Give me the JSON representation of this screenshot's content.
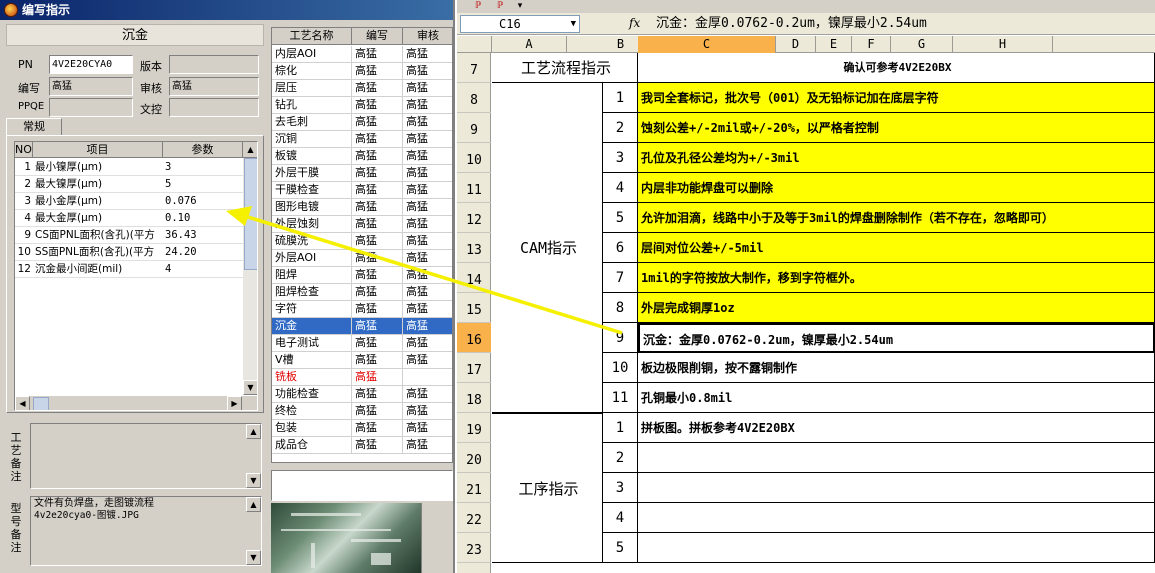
{
  "window": {
    "title": "编写指示"
  },
  "left": {
    "section_button": "沉金",
    "fields": {
      "pn_label": "PN",
      "pn_value": "4V2E20CYA0",
      "version_label": "版本",
      "version_value": "",
      "writer_label": "编写",
      "writer_value": "高猛",
      "reviewer_label": "审核",
      "reviewer_value": "高猛",
      "ppqe_label": "PPQE",
      "ppqe_value": "",
      "control_label": "文控",
      "control_value": ""
    },
    "tab_label": "常规",
    "param_headers": {
      "no": "NO",
      "item": "项目",
      "param": "参数"
    },
    "params": [
      {
        "no": "1",
        "item": "最小镍厚(μm)",
        "value": "3"
      },
      {
        "no": "2",
        "item": "最大镍厚(μm)",
        "value": "5"
      },
      {
        "no": "3",
        "item": "最小金厚(μm)",
        "value": "0.076"
      },
      {
        "no": "4",
        "item": "最大金厚(μm)",
        "value": "0.10"
      },
      {
        "no": "9",
        "item": "CS面PNL面积(含孔)(平方",
        "value": "36.43"
      },
      {
        "no": "10",
        "item": "SS面PNL面积(含孔)(平方",
        "value": "24.20"
      },
      {
        "no": "12",
        "item": "沉金最小间距(mil)",
        "value": "4"
      }
    ],
    "memo1_label": "工艺备注",
    "memo1_text": "",
    "memo2_label": "型号备注",
    "memo2_text_line1": "文件有负焊盘，走图镀流程",
    "memo2_text_line2": "4v2e20cya0-图镀.JPG"
  },
  "process": {
    "headers": {
      "name": "工艺名称",
      "writer": "编写",
      "reviewer": "审核"
    },
    "rows": [
      {
        "name": "内层AOI",
        "writer": "高猛",
        "reviewer": "高猛"
      },
      {
        "name": "棕化",
        "writer": "高猛",
        "reviewer": "高猛"
      },
      {
        "name": "层压",
        "writer": "高猛",
        "reviewer": "高猛"
      },
      {
        "name": "钻孔",
        "writer": "高猛",
        "reviewer": "高猛"
      },
      {
        "name": "去毛刺",
        "writer": "高猛",
        "reviewer": "高猛"
      },
      {
        "name": "沉铜",
        "writer": "高猛",
        "reviewer": "高猛"
      },
      {
        "name": "板镀",
        "writer": "高猛",
        "reviewer": "高猛"
      },
      {
        "name": "外层干膜",
        "writer": "高猛",
        "reviewer": "高猛"
      },
      {
        "name": "干膜检查",
        "writer": "高猛",
        "reviewer": "高猛"
      },
      {
        "name": "图形电镀",
        "writer": "高猛",
        "reviewer": "高猛"
      },
      {
        "name": "外层蚀刻",
        "writer": "高猛",
        "reviewer": "高猛"
      },
      {
        "name": "硫膜洗",
        "writer": "高猛",
        "reviewer": "高猛"
      },
      {
        "name": "外层AOI",
        "writer": "高猛",
        "reviewer": "高猛"
      },
      {
        "name": "阻焊",
        "writer": "高猛",
        "reviewer": "高猛"
      },
      {
        "name": "阻焊检查",
        "writer": "高猛",
        "reviewer": "高猛"
      },
      {
        "name": "字符",
        "writer": "高猛",
        "reviewer": "高猛"
      },
      {
        "name": "沉金",
        "writer": "高猛",
        "reviewer": "高猛"
      },
      {
        "name": "电子测试",
        "writer": "高猛",
        "reviewer": "高猛"
      },
      {
        "name": "V槽",
        "writer": "高猛",
        "reviewer": "高猛"
      },
      {
        "name": "铣板",
        "writer": "高猛",
        "reviewer": ""
      },
      {
        "name": "功能检查",
        "writer": "高猛",
        "reviewer": "高猛"
      },
      {
        "name": "终检",
        "writer": "高猛",
        "reviewer": "高猛"
      },
      {
        "name": "包装",
        "writer": "高猛",
        "reviewer": "高猛"
      },
      {
        "name": "成品仓",
        "writer": "高猛",
        "reviewer": "高猛"
      }
    ],
    "selected_index": 16,
    "red_index": 19
  },
  "sheet": {
    "name_box": "C16",
    "fx_label": "fx",
    "formula": "沉金：金厚0.0762-0.2um，镍厚最小2.54um",
    "columns": [
      "A",
      "B",
      "C",
      "D",
      "E",
      "F",
      "G",
      "H"
    ],
    "row_numbers": [
      "7",
      "8",
      "9",
      "10",
      "11",
      "12",
      "13",
      "14",
      "15",
      "16",
      "17",
      "18",
      "19",
      "20",
      "21",
      "22",
      "23"
    ],
    "header_title": "工艺流程指示",
    "header_note": "确认可参考4V2E20BX",
    "cam_label": "CAM指示",
    "cam_rows": [
      {
        "n": "1",
        "text": "我司全套标记，批次号（001）及无铅标记加在底层字符"
      },
      {
        "n": "2",
        "text": "蚀刻公差+/-2mil或+/-20%，以严格者控制"
      },
      {
        "n": "3",
        "text": "孔位及孔径公差均为+/-3mil"
      },
      {
        "n": "4",
        "text": "内层非功能焊盘可以删除"
      },
      {
        "n": "5",
        "text": "允许加泪滴，线路中小于及等于3mil的焊盘删除制作（若不存在，忽略即可）"
      },
      {
        "n": "6",
        "text": "层间对位公差+/-5mil"
      },
      {
        "n": "7",
        "text": "1mil的字符按放大制作，移到字符框外。"
      },
      {
        "n": "8",
        "text": "外层完成铜厚1oz"
      },
      {
        "n": "9",
        "text": "沉金：金厚0.0762-0.2um，镍厚最小2.54um"
      },
      {
        "n": "10",
        "text": "板边极限削铜，按不露铜制作"
      },
      {
        "n": "11",
        "text": "孔铜最小0.8mil"
      }
    ],
    "proc_label": "工序指示",
    "proc_rows": [
      {
        "n": "1",
        "text": "拼板图。拼板参考4V2E20BX"
      },
      {
        "n": "2",
        "text": ""
      },
      {
        "n": "3",
        "text": ""
      },
      {
        "n": "4",
        "text": ""
      },
      {
        "n": "5",
        "text": ""
      }
    ],
    "highlight_color": "#ffff00"
  }
}
